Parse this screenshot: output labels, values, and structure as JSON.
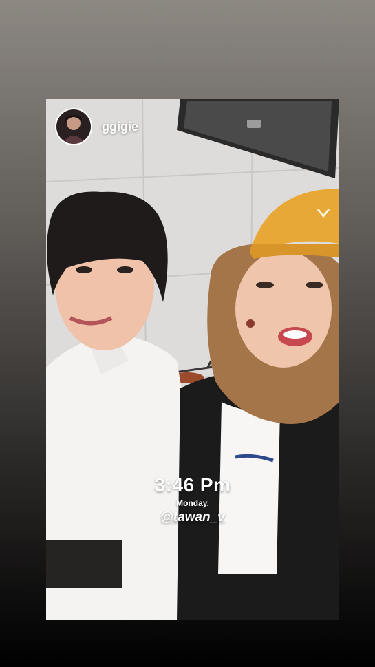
{
  "story": {
    "username": "ggigie",
    "time_sticker": "3:46 Pm",
    "day_sticker": "Monday.",
    "mention": "@tawan_v"
  },
  "colors": {
    "background_top": "#8d8882",
    "background_bottom": "#000000",
    "cap": "#e8a836",
    "text": "#ffffff"
  },
  "icons": {
    "avatar": "profile-photo"
  }
}
